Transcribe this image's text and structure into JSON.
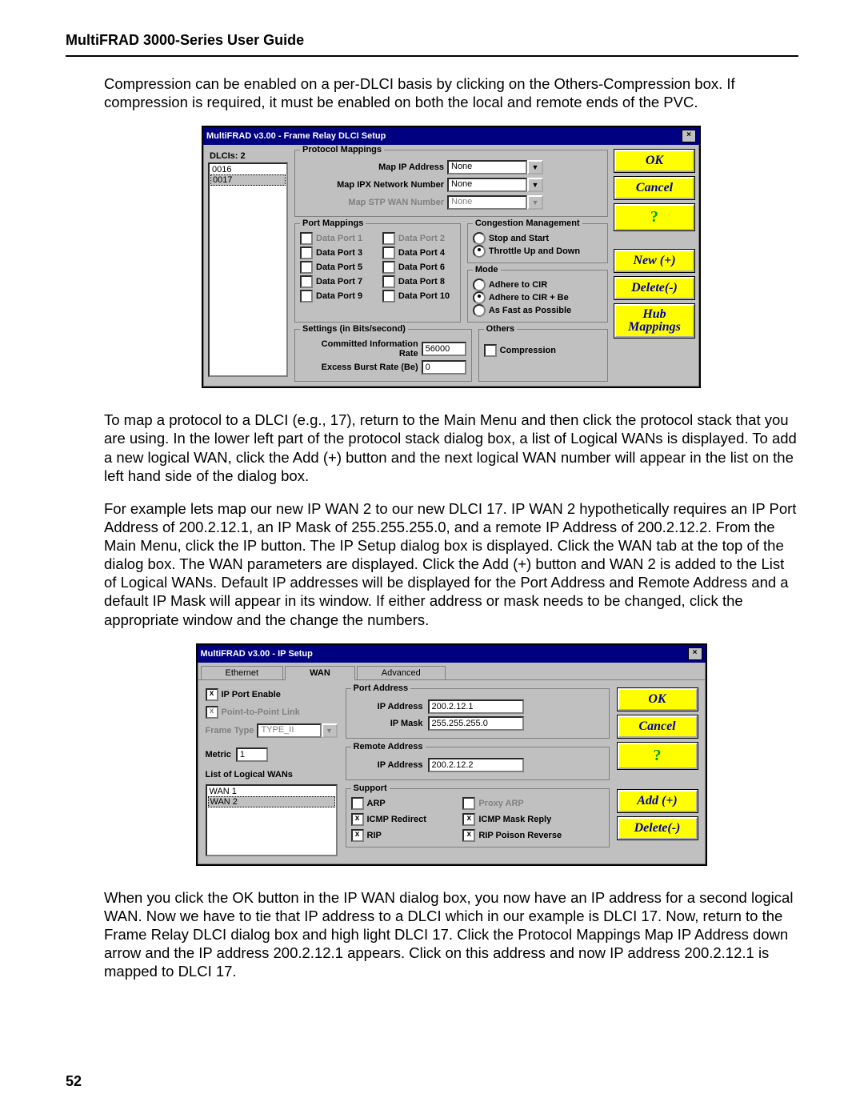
{
  "doc": {
    "header_title": "MultiFRAD 3000-Series User Guide",
    "page_number": "52",
    "para1": "Compression can be enabled on a per-DLCI basis by clicking on the Others-Compression box.  If compression is required, it must be enabled on both the local and remote ends of the PVC.",
    "para2": "To map a protocol to a DLCI (e.g., 17), return to the Main Menu and then click the protocol stack that you are using.  In the lower left part of the protocol stack dialog box, a list of Logical WANs is displayed.  To add a new logical WAN,  click the Add (+) button and the next logical WAN number will appear in the list on the left hand side of the dialog box.",
    "para3": "For example lets map our new IP WAN 2 to our new DLCI 17.  IP WAN 2 hypothetically requires an IP Port Address of 200.2.12.1, an IP Mask of 255.255.255.0, and a remote IP Address of 200.2.12.2.  From the Main Menu, click the IP button.  The IP Setup dialog box is displayed.  Click the WAN tab at the top of the dialog box.  The WAN parameters are displayed.  Click the Add (+) button and WAN 2 is added to the List of Logical WANs.   Default IP addresses will be displayed for the Port Address and Remote Address and a default IP Mask will appear in its window.  If either address or mask needs to be changed, click the appropriate window and the change the numbers.",
    "para4": "When you click the OK button in the IP WAN dialog box, you now have an IP address for a second logical WAN.  Now we have to tie that IP address to a DLCI which in our example is DLCI 17. Now, return to the Frame Relay DLCI dialog box and high light DLCI 17.  Click the Protocol Mappings Map IP Address down arrow and the IP address 200.2.12.1 appears.  Click on this address and now IP address 200.2.12.1 is mapped to DLCI 17."
  },
  "dlg1": {
    "title": "MultiFRAD v3.00 - Frame Relay DLCI Setup",
    "dlcis_label": "DLCIs:  2",
    "dlci_list": [
      "0016",
      "0017"
    ],
    "dlci_selected_index": 1,
    "protomap": {
      "legend": "Protocol Mappings",
      "map_ip_label": "Map IP Address",
      "map_ip_value": "None",
      "map_ipx_label": "Map IPX Network Number",
      "map_ipx_value": "None",
      "map_stp_label": "Map STP WAN Number",
      "map_stp_value": "None"
    },
    "portmap": {
      "legend": "Port Mappings",
      "ports": [
        "Data Port 1",
        "Data Port 2",
        "Data Port 3",
        "Data Port 4",
        "Data Port 5",
        "Data Port 6",
        "Data Port 7",
        "Data Port 8",
        "Data Port 9",
        "Data Port 10"
      ]
    },
    "congestion": {
      "legend": "Congestion Management",
      "opt_stop": "Stop and Start",
      "opt_throttle": "Throttle Up and Down"
    },
    "mode": {
      "legend": "Mode",
      "opt_cir": "Adhere to CIR",
      "opt_cir_be": "Adhere to CIR + Be",
      "opt_fast": "As Fast as Possible"
    },
    "settings": {
      "legend": "Settings (in Bits/second)",
      "cir_label": "Committed Information Rate",
      "cir_value": "56000",
      "be_label": "Excess Burst Rate (Be)",
      "be_value": "0"
    },
    "others": {
      "legend": "Others",
      "compression_label": "Compression"
    },
    "buttons": {
      "ok": "OK",
      "cancel": "Cancel",
      "help": "?",
      "new": "New (+)",
      "delete": "Delete(-)",
      "hub": "Hub Mappings"
    }
  },
  "dlg2": {
    "title": "MultiFRAD v3.00 - IP Setup",
    "tabs": {
      "ethernet": "Ethernet",
      "wan": "WAN",
      "advanced": "Advanced"
    },
    "left": {
      "ip_port_enable": "IP Port Enable",
      "p2p": "Point-to-Point Link",
      "frame_type_label": "Frame Type",
      "frame_type_value": "TYPE_II",
      "metric_label": "Metric",
      "metric_value": "1",
      "list_label": "List of Logical WANs",
      "wan_list": [
        "WAN 1",
        "WAN 2"
      ],
      "wan_selected_index": 1
    },
    "port_addr": {
      "legend": "Port Address",
      "ip_label": "IP Address",
      "ip_value": "200.2.12.1",
      "mask_label": "IP Mask",
      "mask_value": "255.255.255.0"
    },
    "remote_addr": {
      "legend": "Remote Address",
      "ip_label": "IP Address",
      "ip_value": "200.2.12.2"
    },
    "support": {
      "legend": "Support",
      "arp": "ARP",
      "proxy_arp": "Proxy ARP",
      "icmp_redirect": "ICMP Redirect",
      "icmp_mask": "ICMP Mask Reply",
      "rip": "RIP",
      "rip_poison": "RIP Poison Reverse"
    },
    "buttons": {
      "ok": "OK",
      "cancel": "Cancel",
      "help": "?",
      "add": "Add (+)",
      "delete": "Delete(-)"
    }
  }
}
